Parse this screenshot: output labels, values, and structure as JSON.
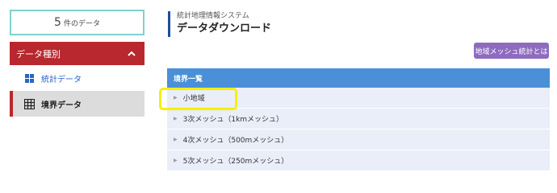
{
  "data_count": {
    "number": "5",
    "unit": "件のデータ"
  },
  "category": {
    "header": "データ種別",
    "items": [
      {
        "label": "統計データ",
        "icon": "statistics-icon"
      },
      {
        "label": "境界データ",
        "icon": "grid-icon"
      }
    ]
  },
  "page": {
    "subtitle": "統計地理情報システム",
    "title": "データダウンロード"
  },
  "mesh_button": "地域メッシュ統計とは",
  "boundary_list": {
    "header": "境界一覧",
    "rows": [
      "小地域",
      "3次メッシュ（1kmメッシュ）",
      "4次メッシュ（500mメッシュ）",
      "5次メッシュ（250mメッシュ）"
    ]
  },
  "colors": {
    "category_header": "#b8282e",
    "list_header": "#4a8fd8",
    "mesh_button": "#8e6bbf",
    "highlight": "#f5f000"
  }
}
